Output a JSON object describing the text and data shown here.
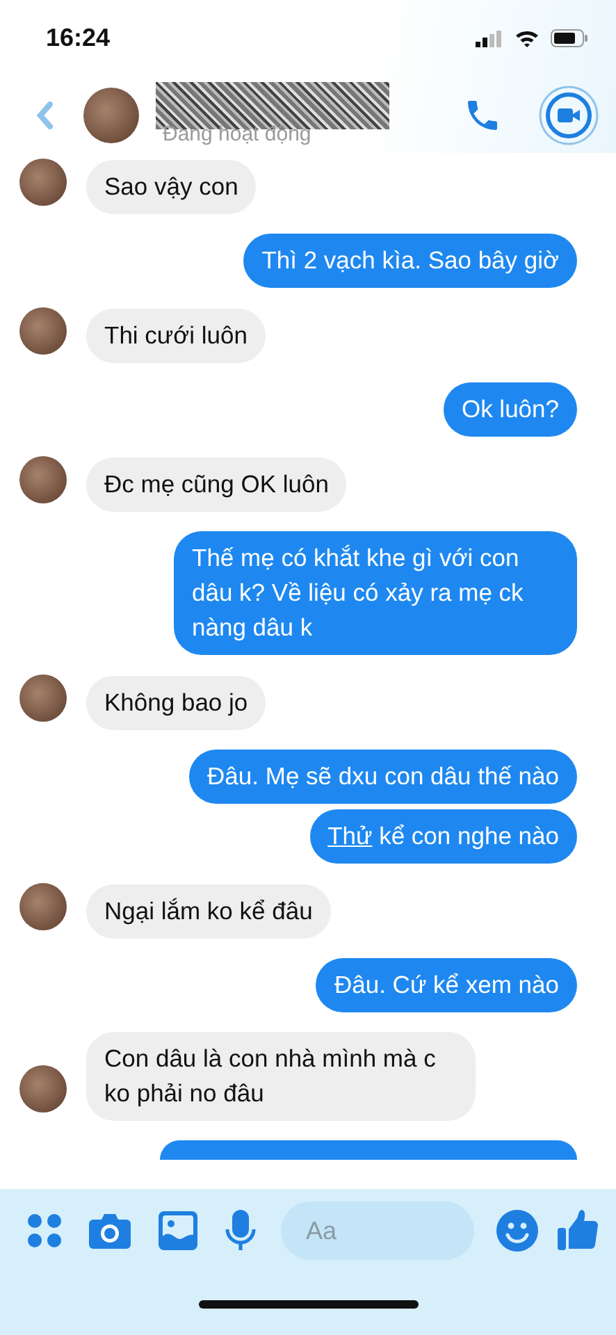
{
  "status_bar": {
    "time": "16:24"
  },
  "header": {
    "presence": "Đang hoạt động"
  },
  "messages": [
    {
      "kind": "incoming",
      "parts": [
        {
          "text": "Sao vậy con",
          "underline": false
        }
      ]
    },
    {
      "kind": "outgoing",
      "parts": [
        {
          "text": "Thì 2 vạch kìa. Sao bây giờ",
          "underline": false
        }
      ]
    },
    {
      "kind": "incoming",
      "parts": [
        {
          "text": "Thi cưới luôn",
          "underline": false
        }
      ]
    },
    {
      "kind": "outgoing",
      "parts": [
        {
          "text": "Ok luôn?",
          "underline": false
        }
      ]
    },
    {
      "kind": "incoming",
      "parts": [
        {
          "text": "Đc mẹ cũng OK luôn",
          "underline": false
        }
      ]
    },
    {
      "kind": "outgoing",
      "parts": [
        {
          "text": "Thế mẹ có khắt khe gì với con dâu k? Về liệu có xảy ra mẹ ck nàng dâu k",
          "underline": false
        }
      ]
    },
    {
      "kind": "incoming",
      "parts": [
        {
          "text": "Không bao jo",
          "underline": false
        }
      ]
    },
    {
      "kind": "outgoing",
      "parts": [
        {
          "text": "Đâu. Mẹ sẽ dxu con dâu thế nào",
          "underline": false
        }
      ]
    },
    {
      "kind": "outgoing",
      "parts": [
        {
          "text": "Thử",
          "underline": true
        },
        {
          "text": " kể con nghe nào",
          "underline": false
        }
      ]
    },
    {
      "kind": "incoming",
      "parts": [
        {
          "text": "Ngại lắm ko kể đâu",
          "underline": false
        }
      ]
    },
    {
      "kind": "outgoing",
      "parts": [
        {
          "text": "Đâu. Cứ kể xem nào",
          "underline": false
        }
      ]
    },
    {
      "kind": "incoming",
      "parts": [
        {
          "text": "Con dâu là con nhà mình mà c ko phải no đâu",
          "underline": false
        }
      ]
    },
    {
      "kind": "partial"
    }
  ],
  "composer": {
    "placeholder": "Aa"
  }
}
